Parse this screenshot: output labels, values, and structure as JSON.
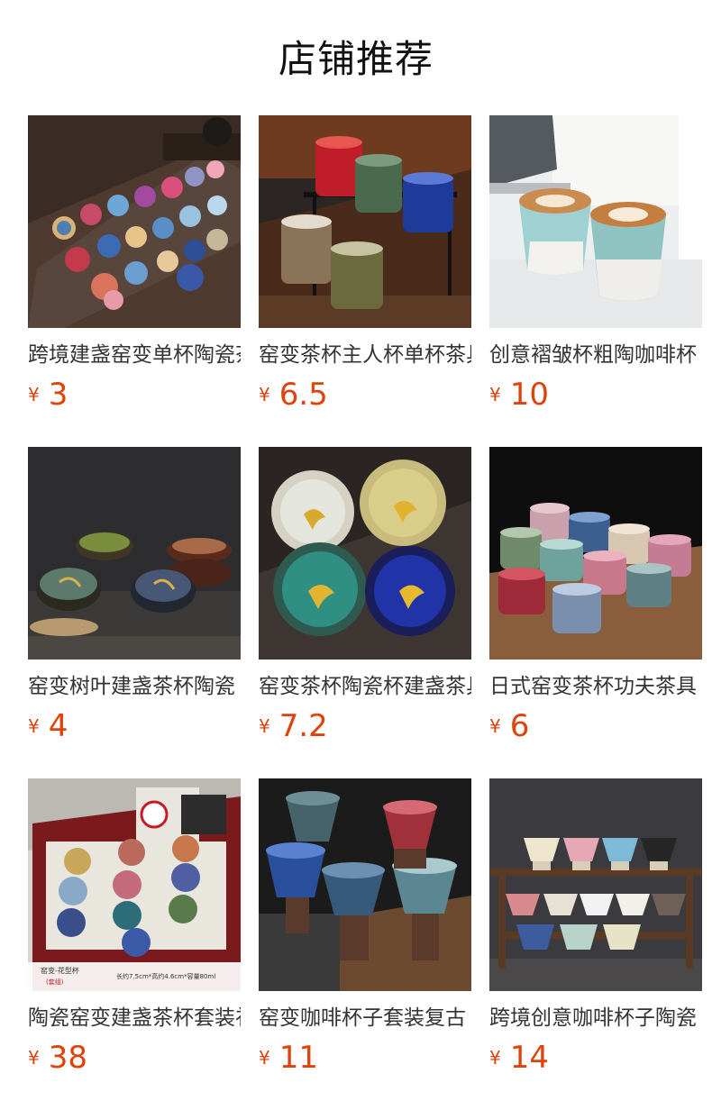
{
  "section_title": "店铺推荐",
  "currency_symbol": "¥",
  "products": [
    {
      "name": "跨境建盏窑变单杯陶瓷茶杯",
      "price": "3",
      "image_icon": "colorful-teacups-on-tray-photo"
    },
    {
      "name": "窑变茶杯主人杯单杯茶具",
      "price": "6.5",
      "image_icon": "kiln-glaze-cups-on-stand-photo"
    },
    {
      "name": "创意褶皱杯粗陶咖啡杯",
      "price": "10",
      "image_icon": "latte-art-cups-photo"
    },
    {
      "name": "窑变树叶建盏茶杯陶瓷",
      "price": "4",
      "image_icon": "leaf-tenmoku-bowls-photo"
    },
    {
      "name": "窑变茶杯陶瓷杯建盏茶具",
      "price": "7.2",
      "image_icon": "ginkgo-leaf-bowls-photo"
    },
    {
      "name": "日式窑变茶杯功夫茶具",
      "price": "6",
      "image_icon": "japanese-kiln-cups-photo"
    },
    {
      "name": "陶瓷窑变建盏茶杯套装礼盒",
      "price": "38",
      "image_icon": "teacup-gift-box-photo"
    },
    {
      "name": "窑变咖啡杯子套装复古",
      "price": "11",
      "image_icon": "coffee-cups-on-wood-bases-photo"
    },
    {
      "name": "跨境创意咖啡杯子陶瓷",
      "price": "14",
      "image_icon": "cups-on-wooden-rack-photo"
    }
  ],
  "gift_box_caption": "窑变-花型杯",
  "gift_box_subcaption": "(套组)",
  "gift_box_spec": "长约7.5cm*高约4.6cm*容量80ml"
}
